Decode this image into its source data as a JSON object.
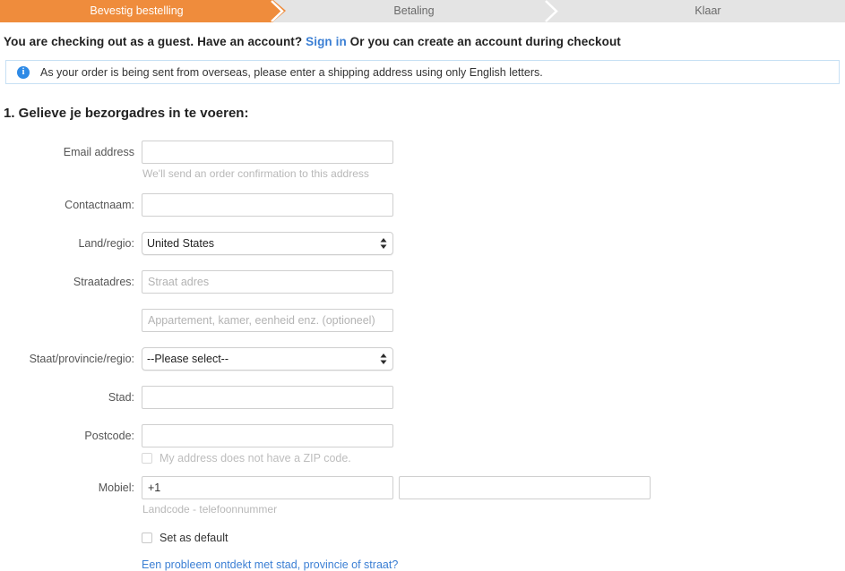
{
  "steps": [
    {
      "label": "Bevestig bestelling",
      "state": "active"
    },
    {
      "label": "Betaling",
      "state": "inactive"
    },
    {
      "label": "Klaar",
      "state": "inactive"
    }
  ],
  "guest": {
    "before_link": "You are checking out as a guest. Have an account?",
    "link": "Sign in",
    "after_link": "Or you can create an account during checkout"
  },
  "info_banner": {
    "icon": "info-circle-icon",
    "text": "As your order is being sent from overseas, please enter a shipping address using only English letters."
  },
  "section": {
    "title": "1. Gelieve je bezorgadres in te voeren:"
  },
  "form": {
    "email": {
      "label": "Email address",
      "value": "",
      "placeholder": "",
      "helper": "We'll send an order confirmation to this address"
    },
    "contact_name": {
      "label": "Contactnaam:",
      "value": "",
      "placeholder": ""
    },
    "country": {
      "label": "Land/regio:",
      "selected": "United States",
      "options": [
        "United States"
      ]
    },
    "street": {
      "label": "Straatadres:",
      "value": "",
      "placeholder": "Straat adres"
    },
    "street2": {
      "label": "",
      "value": "",
      "placeholder": "Appartement, kamer, eenheid enz. (optioneel)"
    },
    "state": {
      "label": "Staat/provincie/regio:",
      "selected": "--Please select--",
      "options": [
        "--Please select--"
      ]
    },
    "city": {
      "label": "Stad:",
      "value": "",
      "placeholder": ""
    },
    "postcode": {
      "label": "Postcode:",
      "value": "",
      "placeholder": "",
      "no_zip_checkbox_label": "My address does not have a ZIP code.",
      "no_zip_checked": false
    },
    "mobile": {
      "label": "Mobiel:",
      "country_code": "+1",
      "number": "",
      "helper": "Landcode - telefoonnummer"
    },
    "set_default": {
      "label": "Set as default",
      "checked": false
    },
    "problem_link": "Een probleem ontdekt met stad, provincie of straat?"
  },
  "colors": {
    "accent_orange": "#ef8c3c",
    "step_bg": "#e4e4e4",
    "link_blue": "#3b7fd4",
    "info_blue": "#2e8ae6",
    "info_border": "#c7e0f4"
  }
}
